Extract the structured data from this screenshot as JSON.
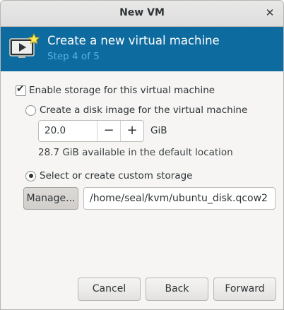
{
  "window": {
    "title": "New VM"
  },
  "header": {
    "title": "Create a new virtual machine",
    "step": "Step 4 of 5"
  },
  "storage": {
    "enable_label": "Enable storage for this virtual machine",
    "enable_checked": true,
    "create_disk_label": "Create a disk image for the virtual machine",
    "disk_size_value": "20.0",
    "decrement_glyph": "−",
    "increment_glyph": "+",
    "disk_unit": "GiB",
    "available_text": "28.7 GiB available in the default location",
    "custom_label": "Select or create custom storage",
    "selected_option": "custom",
    "manage_label": "Manage...",
    "custom_path": "/home/seal/kvm/ubuntu_disk.qcow2"
  },
  "footer": {
    "cancel_label": "Cancel",
    "back_label": "Back",
    "forward_label": "Forward"
  },
  "icons": {
    "close": "close-icon",
    "vm": "vm-screen-star-icon"
  },
  "colors": {
    "header_bg": "#0e6b9f",
    "step_text": "#57b3e6"
  }
}
